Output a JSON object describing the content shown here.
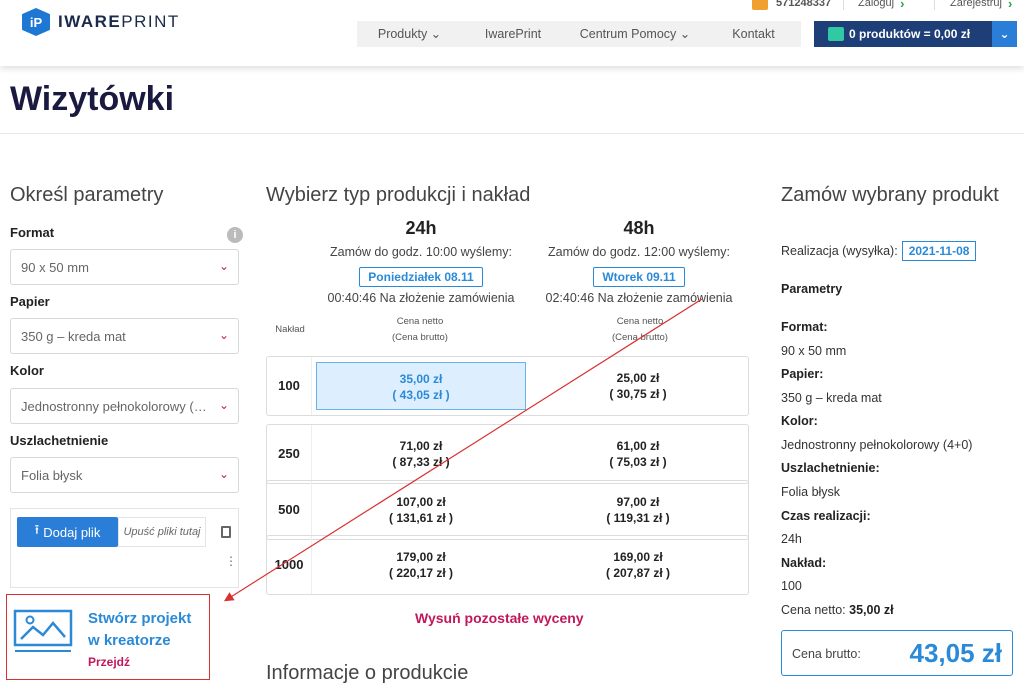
{
  "header": {
    "logo_badge": "iP",
    "logo_bold": "IWARE",
    "logo_light": "PRINT",
    "phone": "571248337",
    "login": "Zaloguj",
    "register": "Zarejestruj",
    "nav": [
      "Produkty ⌄",
      "IwarePrint",
      "Centrum Pomocy ⌄",
      "Kontakt"
    ],
    "cart_label": "0 produktów = 0,00 zł"
  },
  "page_title": "Wizytówki",
  "left": {
    "heading": "Określ parametry",
    "fields": [
      {
        "label": "Format",
        "value": "90 x 50 mm"
      },
      {
        "label": "Papier",
        "value": "350 g – kreda mat"
      },
      {
        "label": "Kolor",
        "value": "Jednostronny pełnokolorowy (4+0)"
      },
      {
        "label": "Uszlachetnienie",
        "value": "Folia błysk"
      }
    ],
    "upload_button": "Dodaj plik",
    "drop_text": "Upuść pliki tutaj",
    "creator_title_1": "Stwórz projekt",
    "creator_title_2": "w kreatorze",
    "creator_link": "Przejdź"
  },
  "middle": {
    "heading": "Wybierz typ produkcji i nakład",
    "col1": {
      "title": "24h",
      "sub": "Zamów do godz. 10:00 wyślemy:",
      "date": "Poniedziałek 08.11",
      "timer": "00:40:46 Na złożenie zamówienia"
    },
    "col2": {
      "title": "48h",
      "sub": "Zamów do godz. 12:00 wyślemy:",
      "date": "Wtorek 09.11",
      "timer": "02:40:46 Na złożenie zamówienia"
    },
    "nakład_label": "Nakład",
    "price_label_1": "Cena netto",
    "price_label_2": "(Cena brutto)",
    "rows": [
      {
        "qty": "100",
        "a_net": "35,00 zł",
        "a_gross": "( 43,05 zł )",
        "b_net": "25,00 zł",
        "b_gross": "( 30,75 zł )"
      },
      {
        "qty": "250",
        "a_net": "71,00 zł",
        "a_gross": "( 87,33 zł )",
        "b_net": "61,00 zł",
        "b_gross": "( 75,03 zł )"
      },
      {
        "qty": "500",
        "a_net": "107,00 zł",
        "a_gross": "( 131,61 zł )",
        "b_net": "97,00 zł",
        "b_gross": "( 119,31 zł )"
      },
      {
        "qty": "1000",
        "a_net": "179,00 zł",
        "a_gross": "( 220,17 zł )",
        "b_net": "169,00 zł",
        "b_gross": "( 207,87 zł )"
      }
    ],
    "more_link": "Wysuń pozostałe wyceny",
    "info_heading": "Informacje o produkcie"
  },
  "right": {
    "heading": "Zamów wybrany produkt",
    "realization_label": "Realizacja (wysyłka):",
    "realization_date": "2021-11-08",
    "params_heading": "Parametry",
    "format_label": "Format:",
    "format_value": "90 x 50 mm",
    "paper_label": "Papier:",
    "paper_value": "350 g – kreda mat",
    "color_label": "Kolor:",
    "color_value": "Jednostronny pełnokolorowy (4+0)",
    "finish_label": "Uszlachetnienie:",
    "finish_value": "Folia błysk",
    "time_label": "Czas realizacji:",
    "time_value": "24h",
    "qty_label": "Nakład:",
    "qty_value": "100",
    "net_label": "Cena netto:",
    "net_value": "35,00 zł",
    "gross_label": "Cena brutto:",
    "gross_value": "43,05 zł"
  },
  "colors": {
    "brand_blue": "#2a8ad8",
    "navy": "#1d3e77",
    "magenta": "#c2185b",
    "annotation_red": "#d93030"
  }
}
